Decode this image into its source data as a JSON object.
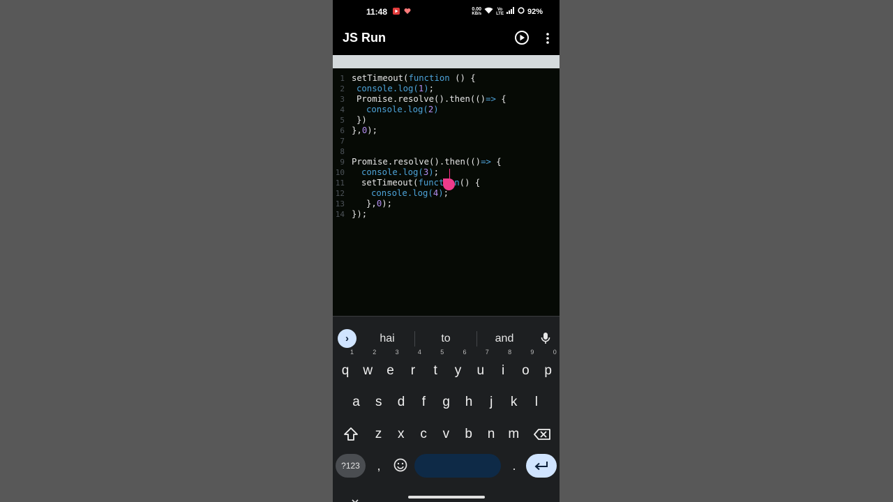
{
  "status_bar": {
    "time": "11:48",
    "net_speed_top": "0.00",
    "net_speed_bottom": "KB/s",
    "carrier_top": "Vo",
    "carrier_bottom": "LTE",
    "battery": "92%"
  },
  "app": {
    "title": "JS Run"
  },
  "editor": {
    "line_numbers": [
      "1",
      "2",
      "3",
      "4",
      "5",
      "6",
      "7",
      "8",
      "9",
      "10",
      "11",
      "12",
      "13",
      "14"
    ],
    "lines": [
      {
        "indent": "",
        "parts": [
          [
            "t-plain",
            "setTimeout("
          ],
          [
            "t-kw",
            "function"
          ],
          [
            "t-plain",
            " () {"
          ]
        ]
      },
      {
        "indent": " ",
        "parts": [
          [
            "t-fn",
            "console.log("
          ],
          [
            "t-num",
            "1"
          ],
          [
            "t-fn",
            ")"
          ],
          [
            "t-plain",
            ";"
          ]
        ]
      },
      {
        "indent": " ",
        "parts": [
          [
            "t-plain",
            "Promise.resolve().then(()"
          ],
          [
            "t-kw",
            "=>"
          ],
          [
            "t-plain",
            " {"
          ]
        ]
      },
      {
        "indent": "   ",
        "parts": [
          [
            "t-fn",
            "console.log("
          ],
          [
            "t-num",
            "2"
          ],
          [
            "t-fn",
            ")"
          ]
        ]
      },
      {
        "indent": " ",
        "parts": [
          [
            "t-plain",
            "})"
          ]
        ]
      },
      {
        "indent": "",
        "parts": [
          [
            "t-plain",
            "},"
          ],
          [
            "t-num",
            "0"
          ],
          [
            "t-plain",
            ");"
          ]
        ]
      },
      {
        "indent": "",
        "parts": []
      },
      {
        "indent": "",
        "parts": []
      },
      {
        "indent": "",
        "parts": [
          [
            "t-plain",
            "Promise.resolve().then(()"
          ],
          [
            "t-kw",
            "=>"
          ],
          [
            "t-plain",
            " {"
          ]
        ]
      },
      {
        "indent": "  ",
        "parts": [
          [
            "t-fn",
            "console.log("
          ],
          [
            "t-num",
            "3"
          ],
          [
            "t-fn",
            ")"
          ],
          [
            "t-plain",
            ";"
          ]
        ]
      },
      {
        "indent": "  ",
        "parts": [
          [
            "t-plain",
            "setTimeout("
          ],
          [
            "t-kw",
            "function"
          ],
          [
            "t-plain",
            "() {"
          ]
        ]
      },
      {
        "indent": "    ",
        "parts": [
          [
            "t-fn",
            "console.log("
          ],
          [
            "t-num",
            "4"
          ],
          [
            "t-fn",
            ")"
          ],
          [
            "t-plain",
            ";"
          ]
        ]
      },
      {
        "indent": "   ",
        "parts": [
          [
            "t-plain",
            "},"
          ],
          [
            "t-num",
            "0"
          ],
          [
            "t-plain",
            ");"
          ]
        ]
      },
      {
        "indent": "",
        "parts": [
          [
            "t-plain",
            "});"
          ]
        ]
      }
    ]
  },
  "keyboard": {
    "suggestions": [
      "hai",
      "to",
      "and"
    ],
    "row1": [
      [
        "q",
        "1"
      ],
      [
        "w",
        "2"
      ],
      [
        "e",
        "3"
      ],
      [
        "r",
        "4"
      ],
      [
        "t",
        "5"
      ],
      [
        "y",
        "6"
      ],
      [
        "u",
        "7"
      ],
      [
        "i",
        "8"
      ],
      [
        "o",
        "9"
      ],
      [
        "p",
        "0"
      ]
    ],
    "row2": [
      "a",
      "s",
      "d",
      "f",
      "g",
      "h",
      "j",
      "k",
      "l"
    ],
    "row3": [
      "z",
      "x",
      "c",
      "v",
      "b",
      "n",
      "m"
    ],
    "symbols_label": "?123",
    "comma": ",",
    "period": "."
  },
  "colors": {
    "background": "#585858",
    "editor_bg": "#060a05",
    "keyword": "#4da3d9",
    "number": "#b48ef2",
    "touch_marker": "#ee3b8b"
  }
}
